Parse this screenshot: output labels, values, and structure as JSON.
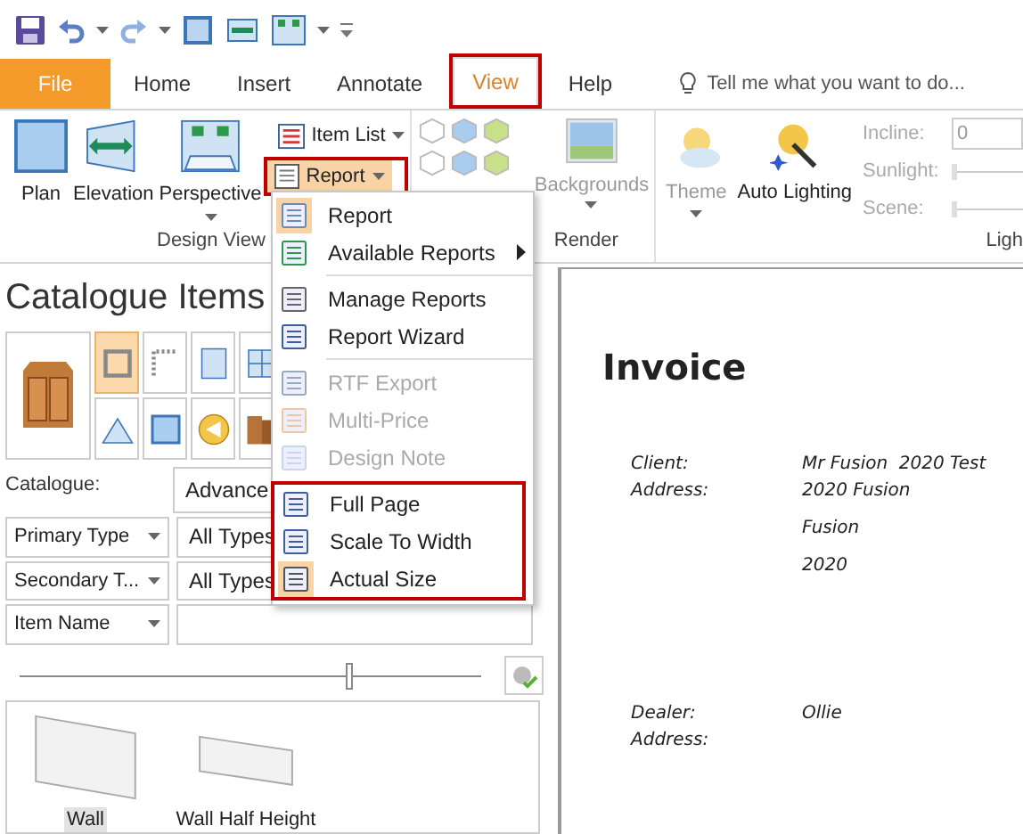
{
  "tabs": [
    {
      "label": "File",
      "kind": "file",
      "selected": false,
      "highlighted": false
    },
    {
      "label": "Home",
      "kind": "tab",
      "selected": false,
      "highlighted": false
    },
    {
      "label": "Insert",
      "kind": "tab",
      "selected": false,
      "highlighted": false
    },
    {
      "label": "Annotate",
      "kind": "tab",
      "selected": false,
      "highlighted": false
    },
    {
      "label": "View",
      "kind": "tab",
      "selected": true,
      "highlighted": true
    },
    {
      "label": "Help",
      "kind": "tab",
      "selected": false,
      "highlighted": false
    }
  ],
  "tell_me": {
    "placeholder": "Tell me what you want to do..."
  },
  "design_view": {
    "label": "Design View",
    "large_buttons": [
      "Plan",
      "Elevation",
      "Perspective"
    ],
    "item_list": "Item List",
    "report": {
      "label": "Report",
      "highlighted": true
    }
  },
  "render": {
    "label": "Render",
    "backgrounds": "Backgrounds"
  },
  "lighting": {
    "label": "Ligh",
    "theme": "Theme",
    "auto_lighting": "Auto Lighting",
    "fields": [
      {
        "label": "Incline:",
        "kind": "input",
        "value": "0"
      },
      {
        "label": "Sunlight:",
        "kind": "slider",
        "level": 0
      },
      {
        "label": "Scene:",
        "kind": "slider",
        "level": 0
      }
    ]
  },
  "report_menu": {
    "sections": [
      {
        "highlighted": false,
        "items": [
          {
            "label": "Report",
            "selected": true,
            "disabled": false,
            "submenu": false
          },
          {
            "label": "Available Reports",
            "selected": false,
            "disabled": false,
            "submenu": true
          }
        ]
      },
      {
        "highlighted": false,
        "items": [
          {
            "label": "Manage Reports",
            "selected": false,
            "disabled": false,
            "submenu": false
          },
          {
            "label": "Report Wizard",
            "selected": false,
            "disabled": false,
            "submenu": false
          }
        ]
      },
      {
        "highlighted": false,
        "items": [
          {
            "label": "RTF Export",
            "selected": false,
            "disabled": true,
            "submenu": false
          },
          {
            "label": "Multi-Price",
            "selected": false,
            "disabled": true,
            "submenu": false
          },
          {
            "label": "Design Note",
            "selected": false,
            "disabled": true,
            "submenu": false
          }
        ]
      },
      {
        "highlighted": true,
        "items": [
          {
            "label": "Full Page",
            "selected": false,
            "disabled": false,
            "submenu": false
          },
          {
            "label": "Scale To Width",
            "selected": false,
            "disabled": false,
            "submenu": false
          },
          {
            "label": "Actual Size",
            "selected": true,
            "disabled": false,
            "submenu": false
          }
        ]
      }
    ]
  },
  "catalogue": {
    "title": "Catalogue Items",
    "tiles": [
      {
        "selected": false
      },
      {
        "selected": true
      },
      {
        "selected": false
      },
      {
        "selected": false
      },
      {
        "selected": false
      },
      {
        "selected": false
      },
      {
        "selected": false
      },
      {
        "selected": false
      },
      {
        "selected": false
      }
    ],
    "catalogue_label": "Catalogue:",
    "catalogue_value": "Advance",
    "filters": [
      {
        "type": "Primary Type",
        "value": "All Types"
      },
      {
        "type": "Secondary T...",
        "value": "All Types"
      },
      {
        "type": "Item Name"
      }
    ],
    "size_slider": {
      "level": 0.7
    },
    "items": [
      {
        "label": "Wall",
        "selected": true
      },
      {
        "label": "Wall Half Height",
        "selected": false
      }
    ]
  },
  "document": {
    "title": "Invoice",
    "blocks": [
      [
        {
          "label": "Client:",
          "lines": [
            "Mr Fusion  2020 Test"
          ]
        },
        {
          "label": "Address:",
          "lines": [
            "2020 Fusion",
            "Fusion",
            "2020"
          ]
        }
      ],
      [
        {
          "label": "Dealer:",
          "lines": [
            "Ollie"
          ]
        },
        {
          "label": "Address:"
        }
      ]
    ]
  }
}
